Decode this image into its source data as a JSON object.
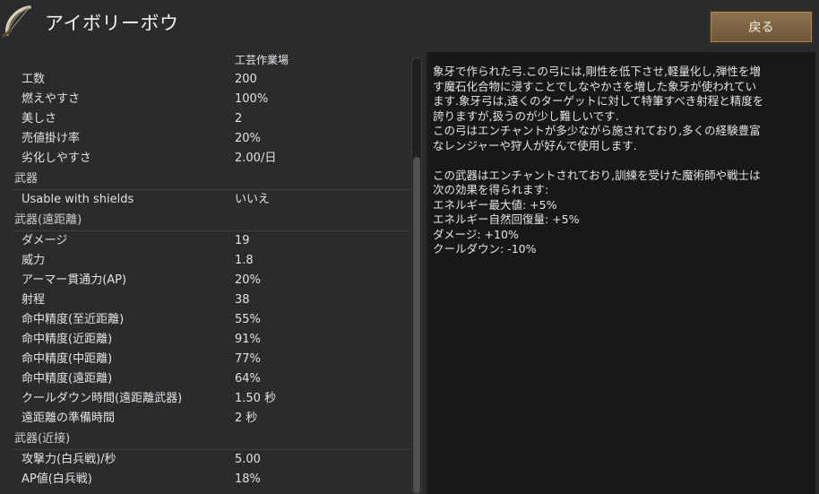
{
  "header": {
    "title": "アイボリーボウ",
    "back_label": "戻る"
  },
  "stats": {
    "column_header": "工芸作業場",
    "rows": [
      {
        "label": "工数",
        "value": "200"
      },
      {
        "label": "燃えやすさ",
        "value": "100%"
      },
      {
        "label": "美しさ",
        "value": "2"
      },
      {
        "label": "売値掛け率",
        "value": "20%"
      },
      {
        "label": "劣化しやすさ",
        "value": "2.00/日"
      },
      {
        "category": "武器"
      },
      {
        "label": "Usable with shields",
        "value": "いいえ"
      },
      {
        "category": "武器(遠距離)"
      },
      {
        "label": "ダメージ",
        "value": "19"
      },
      {
        "label": "威力",
        "value": "1.8"
      },
      {
        "label": "アーマー貫通力(AP)",
        "value": "20%"
      },
      {
        "label": "射程",
        "value": "38"
      },
      {
        "label": "命中精度(至近距離)",
        "value": "55%"
      },
      {
        "label": "命中精度(近距離)",
        "value": "91%"
      },
      {
        "label": "命中精度(中距離)",
        "value": "77%"
      },
      {
        "label": "命中精度(遠距離)",
        "value": "64%"
      },
      {
        "label": "クールダウン時間(遠距離武器)",
        "value": "1.50 秒"
      },
      {
        "label": "遠距離の準備時間",
        "value": "2 秒"
      },
      {
        "category": "武器(近接)"
      },
      {
        "label": "攻撃力(白兵戦)/秒",
        "value": "5.00"
      },
      {
        "label": "AP値(白兵戦)",
        "value": "18%"
      }
    ]
  },
  "description": {
    "lines": [
      "象牙で作られた弓.この弓には,剛性を低下させ,軽量化し,弾性を増",
      "す魔石化合物に浸すことでしなやかさを増した象牙が使われてい",
      "ます.象牙弓は,遠くのターゲットに対して特筆すべき射程と精度を",
      "誇りますが,扱うのが少し難しいです.",
      "この弓はエンチャントが多少ながら施されており,多くの経験豊富",
      "なレンジャーや狩人が好んで使用します.",
      "",
      "この武器はエンチャントされており,訓練を受けた魔術師や戦士は",
      "次の効果を得られます:",
      "エネルギー最大値: +5%",
      "エネルギー自然回復量: +5%",
      "ダメージ: +10%",
      "クールダウン: -10%"
    ]
  },
  "icons": {
    "item": "bow-icon"
  }
}
